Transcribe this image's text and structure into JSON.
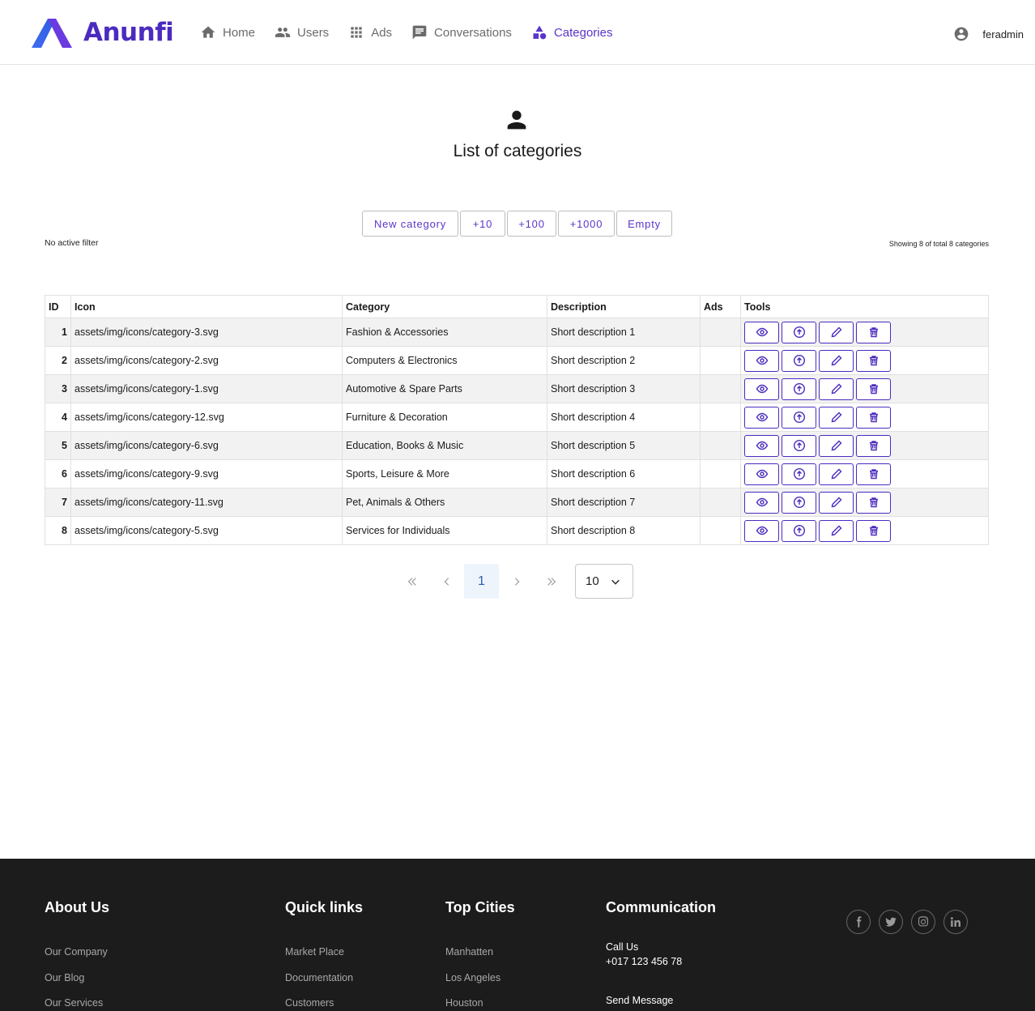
{
  "brand": {
    "name": "Anunfi",
    "accent": "#5b35c9"
  },
  "nav": {
    "items": [
      {
        "label": "Home",
        "icon": "home-icon"
      },
      {
        "label": "Users",
        "icon": "users-icon"
      },
      {
        "label": "Ads",
        "icon": "grid-icon"
      },
      {
        "label": "Conversations",
        "icon": "chat-icon"
      },
      {
        "label": "Categories",
        "icon": "shapes-icon",
        "active": true
      }
    ],
    "user": "feradmin"
  },
  "page": {
    "title": "List of categories"
  },
  "toolbar": {
    "buttons": [
      "New category",
      "+10",
      "+100",
      "+1000",
      "Empty"
    ],
    "filter_status": "No active filter",
    "showing": "Showing 8 of total 8 categories"
  },
  "table": {
    "headers": [
      "ID",
      "Icon",
      "Category",
      "Description",
      "Ads",
      "Tools"
    ],
    "rows": [
      {
        "id": "1",
        "icon": "assets/img/icons/category-3.svg",
        "category": "Fashion & Accessories",
        "description": "Short description 1",
        "ads": ""
      },
      {
        "id": "2",
        "icon": "assets/img/icons/category-2.svg",
        "category": "Computers & Electronics",
        "description": "Short description 2",
        "ads": ""
      },
      {
        "id": "3",
        "icon": "assets/img/icons/category-1.svg",
        "category": "Automotive & Spare Parts",
        "description": "Short description 3",
        "ads": ""
      },
      {
        "id": "4",
        "icon": "assets/img/icons/category-12.svg",
        "category": "Furniture & Decoration",
        "description": "Short description 4",
        "ads": ""
      },
      {
        "id": "5",
        "icon": "assets/img/icons/category-6.svg",
        "category": "Education, Books & Music",
        "description": "Short description 5",
        "ads": ""
      },
      {
        "id": "6",
        "icon": "assets/img/icons/category-9.svg",
        "category": "Sports, Leisure & More",
        "description": "Short description 6",
        "ads": ""
      },
      {
        "id": "7",
        "icon": "assets/img/icons/category-11.svg",
        "category": "Pet, Animals & Others",
        "description": "Short description 7",
        "ads": ""
      },
      {
        "id": "8",
        "icon": "assets/img/icons/category-5.svg",
        "category": "Services for Individuals",
        "description": "Short description 8",
        "ads": ""
      }
    ],
    "tool_icons": [
      "eye-icon",
      "arrow-up-circle-icon",
      "pencil-icon",
      "trash-icon"
    ]
  },
  "pagination": {
    "current": "1",
    "page_size": "10"
  },
  "footer": {
    "about": {
      "title": "About Us",
      "links": [
        "Our Company",
        "Our Blog",
        "Our Services"
      ]
    },
    "quick": {
      "title": "Quick links",
      "links": [
        "Market Place",
        "Documentation",
        "Customers"
      ]
    },
    "cities": {
      "title": "Top Cities",
      "links": [
        "Manhatten",
        "Los Angeles",
        "Houston"
      ]
    },
    "communication": {
      "title": "Communication",
      "call_label": "Call Us",
      "phone": "+017 123 456 78",
      "message_label": "Send Message"
    },
    "socials": [
      "facebook-icon",
      "twitter-icon",
      "instagram-icon",
      "linkedin-icon"
    ]
  }
}
